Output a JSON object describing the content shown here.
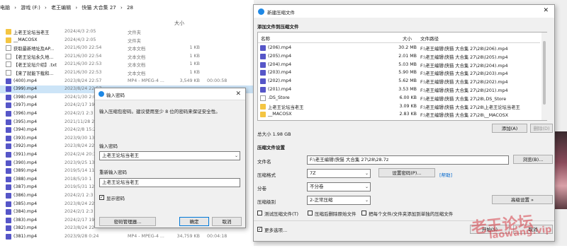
{
  "explorer": {
    "breadcrumb": [
      "电脑",
      "›",
      "游戏 (F:)",
      "›",
      "老王编辑",
      "›",
      "快猫 大合集 27",
      "›",
      "28"
    ],
    "columns": {
      "date": "2024/4/3 2:05",
      "type": "文件夹",
      "size": "大小"
    },
    "header": {
      "date": "2024/4/3 2:05",
      "type": "文件夹",
      "size": "大小"
    },
    "files": [
      {
        "kind": "folder",
        "name": "上老王论坛当老王",
        "date": "2024/4/3 2:05",
        "type": "文件夹",
        "size": "",
        "dur": ""
      },
      {
        "kind": "folder",
        "name": "__MACOSX",
        "date": "2024/4/3 2:05",
        "type": "文件夹",
        "size": "",
        "dur": ""
      },
      {
        "kind": "txt",
        "name": "获取最新地址及AP...",
        "date": "2021/6/30 22:54",
        "type": "文本文档",
        "size": "1 KB",
        "dur": ""
      },
      {
        "kind": "txt",
        "name": "【老王论坛永久地...",
        "date": "2021/6/30 22:54",
        "type": "文本文档",
        "size": "1 KB",
        "dur": ""
      },
      {
        "kind": "txt",
        "name": "【老王论坛介绍】.txt",
        "date": "2021/6/30 22:53",
        "type": "文本文档",
        "size": "1 KB",
        "dur": ""
      },
      {
        "kind": "txt",
        "name": "【来了就能下载和...",
        "date": "2021/6/30 22:53",
        "type": "文本文档",
        "size": "1 KB",
        "dur": ""
      },
      {
        "kind": "vid",
        "name": "(400).mp4",
        "date": "2023/8/24 22:57",
        "type": "MP4 - MPEG-4 ...",
        "size": "3,549 KB",
        "dur": "00:00:58"
      },
      {
        "kind": "vid",
        "name": "(399).mp4",
        "date": "2023/8/24 22:57",
        "type": "",
        "size": "",
        "dur": "",
        "selected": true
      },
      {
        "kind": "vid",
        "name": "(398).mp4",
        "date": "2024/1/30 2:0",
        "type": "",
        "size": "",
        "dur": ""
      },
      {
        "kind": "vid",
        "name": "(397).mp4",
        "date": "2024/2/17 19",
        "type": "",
        "size": "",
        "dur": ""
      },
      {
        "kind": "vid",
        "name": "(396).mp4",
        "date": "2024/2/1 2:3",
        "type": "",
        "size": "",
        "dur": ""
      },
      {
        "kind": "vid",
        "name": "(395).mp4",
        "date": "2021/11/28 2",
        "type": "",
        "size": "",
        "dur": ""
      },
      {
        "kind": "vid",
        "name": "(394).mp4",
        "date": "2024/2/8 15:2",
        "type": "",
        "size": "",
        "dur": ""
      },
      {
        "kind": "vid",
        "name": "(393).mp4",
        "date": "2023/9/30 13",
        "type": "",
        "size": "",
        "dur": ""
      },
      {
        "kind": "vid",
        "name": "(392).mp4",
        "date": "2023/8/24 22",
        "type": "",
        "size": "",
        "dur": ""
      },
      {
        "kind": "vid",
        "name": "(391).mp4",
        "date": "2024/2/4 20:3",
        "type": "",
        "size": "",
        "dur": ""
      },
      {
        "kind": "vid",
        "name": "(390).mp4",
        "date": "2023/9/25 13",
        "type": "",
        "size": "",
        "dur": ""
      },
      {
        "kind": "vid",
        "name": "(389).mp4",
        "date": "2019/5/14 11",
        "type": "",
        "size": "",
        "dur": ""
      },
      {
        "kind": "vid",
        "name": "(388).mp4",
        "date": "2018/5/10 1",
        "type": "",
        "size": "",
        "dur": ""
      },
      {
        "kind": "vid",
        "name": "(387).mp4",
        "date": "2019/5/31 12",
        "type": "",
        "size": "",
        "dur": ""
      },
      {
        "kind": "vid",
        "name": "(386).mp4",
        "date": "2024/2/1 2:3",
        "type": "",
        "size": "",
        "dur": ""
      },
      {
        "kind": "vid",
        "name": "(385).mp4",
        "date": "2023/8/24 22",
        "type": "",
        "size": "",
        "dur": ""
      },
      {
        "kind": "vid",
        "name": "(384).mp4",
        "date": "2024/2/1 2:3",
        "type": "",
        "size": "",
        "dur": ""
      },
      {
        "kind": "vid",
        "name": "(383).mp4",
        "date": "2024/2/17 19",
        "type": "",
        "size": "",
        "dur": ""
      },
      {
        "kind": "vid",
        "name": "(382).mp4",
        "date": "2023/8/24 22",
        "type": "",
        "size": "",
        "dur": ""
      },
      {
        "kind": "vid",
        "name": "(381).mp4",
        "date": "2023/9/28 0:24",
        "type": "MP4 - MPEG-4 ...",
        "size": "34,759 KB",
        "dur": "00:04:18"
      }
    ]
  },
  "password_dialog": {
    "title": "输入密码",
    "instruction": "输入压缩包密码。建议使用至少 8 位的密码来保证安全性。",
    "enter_label": "输入密码",
    "enter_value": "上老王论坛当老王",
    "reenter_label": "重新输入密码",
    "reenter_value": "上老王论坛当老王",
    "show_password": "显示密码",
    "manager_button": "密码管理器...",
    "ok_button": "确定",
    "cancel_button": "取消"
  },
  "zip_dialog": {
    "title": "新建压缩文件",
    "section_add": "添加文件到压缩文件",
    "col_name": "名称",
    "col_size": "大小",
    "col_path": "文件路径",
    "files": [
      {
        "kind": "vid",
        "name": "(206).mp4",
        "size": "30.2 MB",
        "path": "F:\\老王编辑\\快猫 大合集 27\\28\\(206).mp4"
      },
      {
        "kind": "vid",
        "name": "(205).mp4",
        "size": "2.01 MB",
        "path": "F:\\老王编辑\\快猫 大合集 27\\28\\(205).mp4"
      },
      {
        "kind": "vid",
        "name": "(204).mp4",
        "size": "5.03 MB",
        "path": "F:\\老王编辑\\快猫 大合集 27\\28\\(204).mp4"
      },
      {
        "kind": "vid",
        "name": "(203).mp4",
        "size": "5.90 MB",
        "path": "F:\\老王编辑\\快猫 大合集 27\\28\\(203).mp4"
      },
      {
        "kind": "vid",
        "name": "(202).mp4",
        "size": "5.62 MB",
        "path": "F:\\老王编辑\\快猫 大合集 27\\28\\(202).mp4"
      },
      {
        "kind": "vid",
        "name": "(201).mp4",
        "size": "3.53 MB",
        "path": "F:\\老王编辑\\快猫 大合集 27\\28\\(201).mp4"
      },
      {
        "kind": "txt",
        "name": ".DS_Store",
        "size": "6.00 KB",
        "path": "F:\\老王编辑\\快猫 大合集 27\\28\\.DS_Store"
      },
      {
        "kind": "folder",
        "name": "上老王论坛当老王",
        "size": "3.09 KB",
        "path": "F:\\老王编辑\\快猫 大合集 27\\28\\上老王论坛当老王"
      },
      {
        "kind": "folder",
        "name": "__MACOSX",
        "size": "2.83 KB",
        "path": "F:\\老王编辑\\快猫 大合集 27\\28\\__MACOSX"
      }
    ],
    "total_size": "总大小 1.98 GB",
    "add_button": "添加(A)",
    "remove_button": "删除(D)",
    "section_settings": "压缩文件设置",
    "filename_label": "文件名",
    "filename_value": "F:\\老王编辑\\快猫 大合集 27\\28\\28.7z",
    "browse_button": "浏览(B)...",
    "format_label": "压缩格式",
    "format_value": "7Z",
    "set_password_button": "设置密码(P)...",
    "help_link": "[帮助]",
    "split_label": "分卷",
    "split_value": "不分卷",
    "level_label": "压缩级别",
    "level_value": "2-正常压缩",
    "advanced_button": "高级设置 »",
    "test_label": "测试压缩文件(T)",
    "delete_label": "压缩后删除原始文件",
    "separate_label": "把每个文件/文件夹添加到单独的压缩文件",
    "more_options": "更多选项...",
    "start_button": "开始(S)",
    "cancel_button": "取消"
  },
  "watermark": {
    "line1": "老王论坛",
    "line2": "laowang.vip"
  }
}
